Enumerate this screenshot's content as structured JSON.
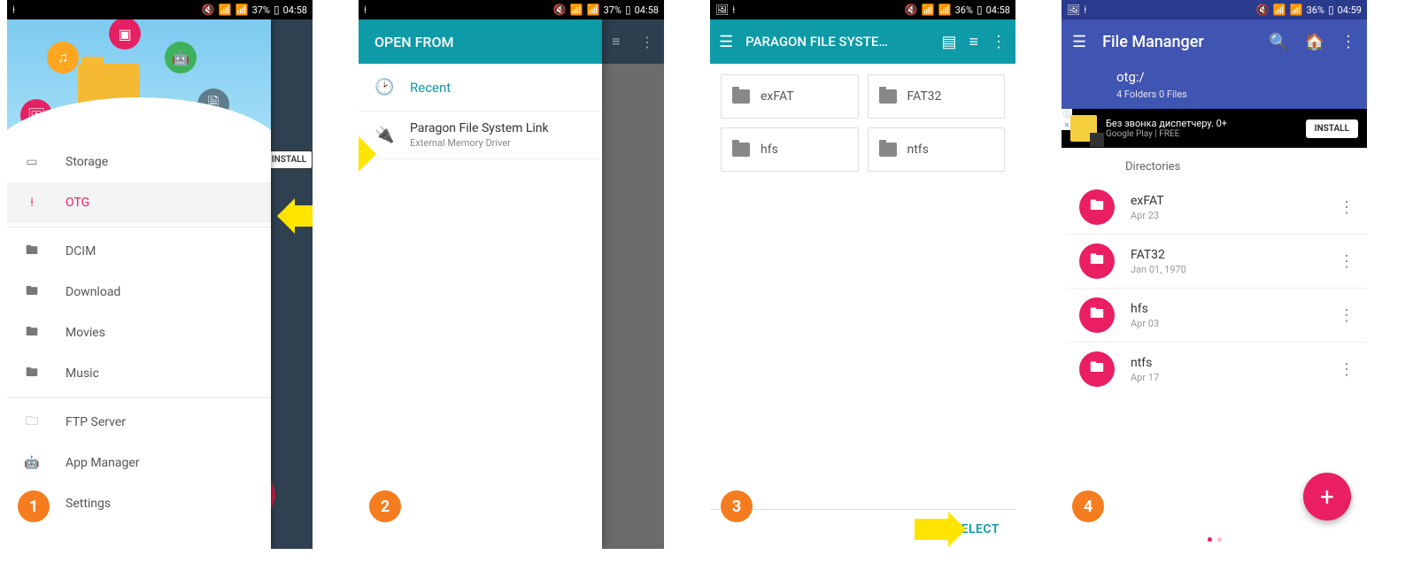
{
  "statusbar": {
    "battery37": "37%",
    "battery36": "36%",
    "time58": "04:58",
    "time59": "04:59"
  },
  "steps": {
    "s1": "1",
    "s2": "2",
    "s3": "3",
    "s4": "4"
  },
  "s1": {
    "install": "INSTALL",
    "items": [
      {
        "label": "Storage",
        "icon": "▭"
      },
      {
        "label": "OTG",
        "icon": "⍿",
        "active": true
      },
      {
        "label": "DCIM",
        "icon": "🖿"
      },
      {
        "label": "Download",
        "icon": "🖿"
      },
      {
        "label": "Movies",
        "icon": "🖿"
      },
      {
        "label": "Music",
        "icon": "🖿"
      },
      {
        "label": "FTP Server",
        "icon": "🗀"
      },
      {
        "label": "App Manager",
        "icon": "🤖"
      },
      {
        "label": "Settings",
        "icon": "⚙"
      }
    ]
  },
  "s2": {
    "title": "OPEN FROM",
    "recent": "Recent",
    "pfs_title": "Paragon File System Link",
    "pfs_sub": "External Memory Driver"
  },
  "s3": {
    "title": "PARAGON FILE SYSTE…",
    "items": [
      "exFAT",
      "FAT32",
      "hfs",
      "ntfs"
    ],
    "select": "SELECT"
  },
  "s4": {
    "title": "File Mananger",
    "path": "otg:/",
    "sub": "4 Folders 0 Files",
    "ad_line1": "Без звонка диспетчеру. 0+",
    "ad_line2": "Google Play   |   FREE",
    "ad_btn": "INSTALL",
    "section": "Directories",
    "items": [
      {
        "name": "exFAT",
        "date": "Apr 23"
      },
      {
        "name": "FAT32",
        "date": "Jan 01, 1970"
      },
      {
        "name": "hfs",
        "date": "Apr 03"
      },
      {
        "name": "ntfs",
        "date": "Apr 17"
      }
    ]
  }
}
